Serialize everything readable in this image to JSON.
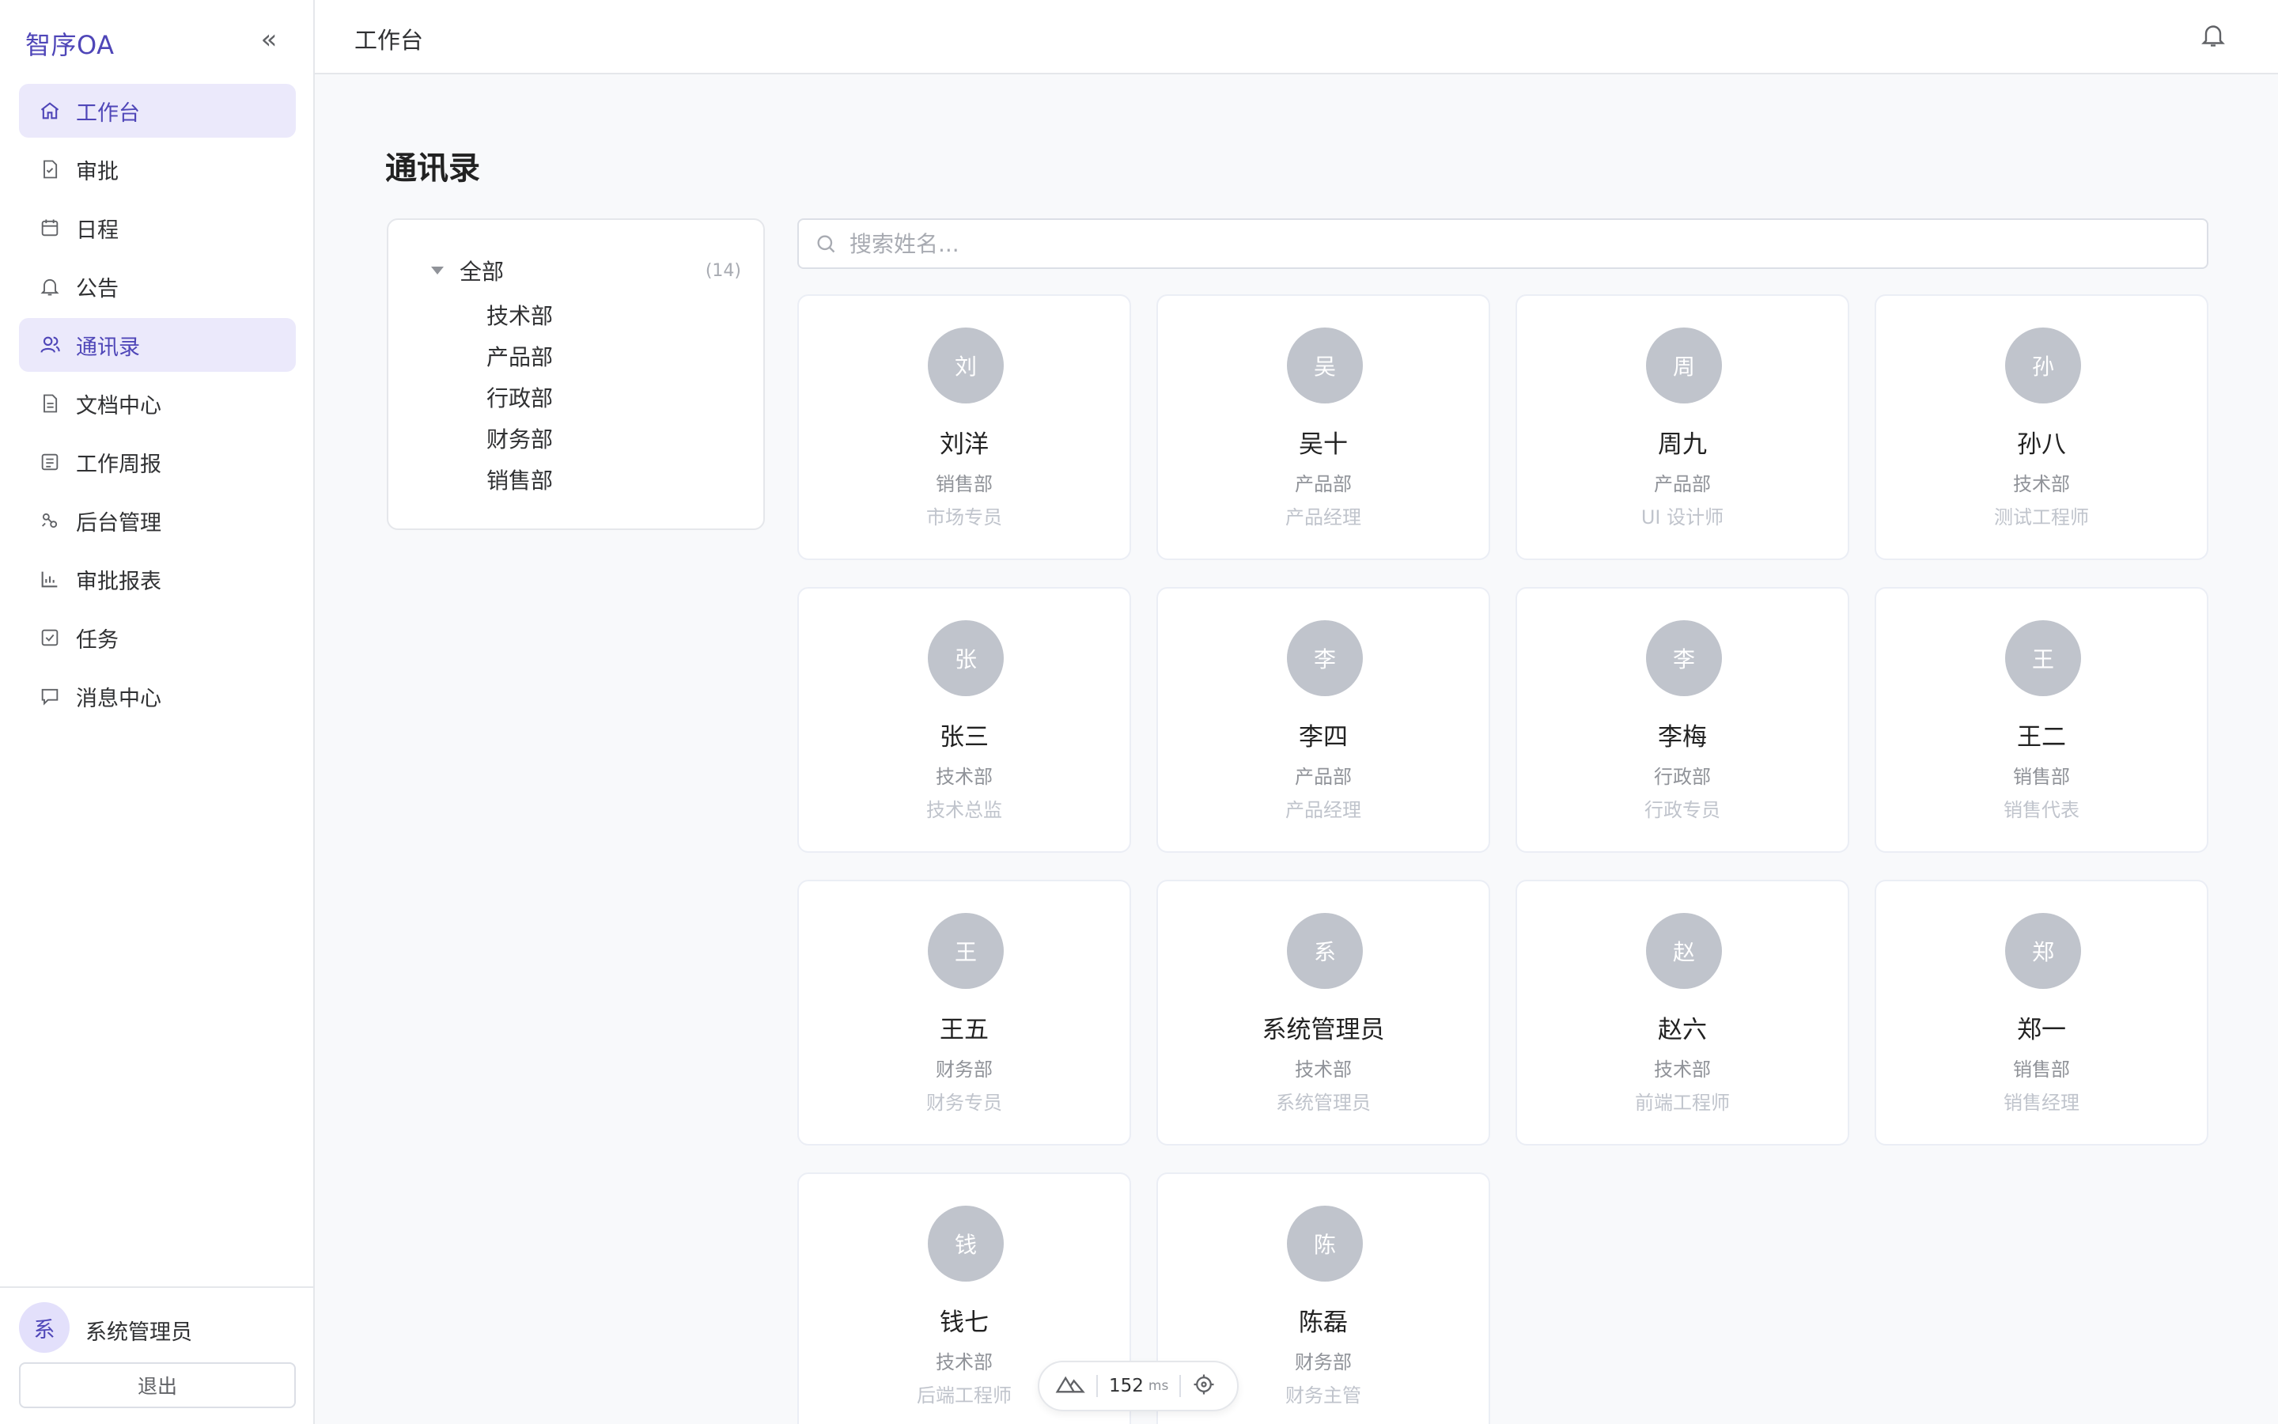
{
  "app": {
    "brand": "智序OA",
    "collapse_glyph": "«"
  },
  "sidebar": {
    "items": [
      {
        "label": "工作台",
        "icon": "home-icon",
        "active": true
      },
      {
        "label": "审批",
        "icon": "approval-doc-icon",
        "active": false
      },
      {
        "label": "日程",
        "icon": "calendar-icon",
        "active": false
      },
      {
        "label": "公告",
        "icon": "bell-icon",
        "active": false
      },
      {
        "label": "通讯录",
        "icon": "contacts-icon",
        "active": true
      },
      {
        "label": "文档中心",
        "icon": "document-icon",
        "active": false
      },
      {
        "label": "工作周报",
        "icon": "report-icon",
        "active": false
      },
      {
        "label": "后台管理",
        "icon": "admin-icon",
        "active": false
      },
      {
        "label": "审批报表",
        "icon": "bar-chart-icon",
        "active": false
      },
      {
        "label": "任务",
        "icon": "task-check-icon",
        "active": false
      },
      {
        "label": "消息中心",
        "icon": "message-icon",
        "active": false
      }
    ],
    "user": {
      "avatar": "系",
      "name": "系统管理员"
    },
    "logout_label": "退出"
  },
  "header": {
    "title": "工作台",
    "notification_icon": "bell-icon"
  },
  "main": {
    "title": "通讯录",
    "tree": {
      "root_label": "全部",
      "root_count": "(14)",
      "children": [
        "技术部",
        "产品部",
        "行政部",
        "财务部",
        "销售部"
      ]
    },
    "search": {
      "placeholder": "搜索姓名...",
      "value": ""
    },
    "contacts": [
      {
        "avatar": "刘",
        "name": "刘洋",
        "dept": "销售部",
        "role": "市场专员"
      },
      {
        "avatar": "吴",
        "name": "吴十",
        "dept": "产品部",
        "role": "产品经理"
      },
      {
        "avatar": "周",
        "name": "周九",
        "dept": "产品部",
        "role": "UI 设计师"
      },
      {
        "avatar": "孙",
        "name": "孙八",
        "dept": "技术部",
        "role": "测试工程师"
      },
      {
        "avatar": "张",
        "name": "张三",
        "dept": "技术部",
        "role": "技术总监"
      },
      {
        "avatar": "李",
        "name": "李四",
        "dept": "产品部",
        "role": "产品经理"
      },
      {
        "avatar": "李",
        "name": "李梅",
        "dept": "行政部",
        "role": "行政专员"
      },
      {
        "avatar": "王",
        "name": "王二",
        "dept": "销售部",
        "role": "销售代表"
      },
      {
        "avatar": "王",
        "name": "王五",
        "dept": "财务部",
        "role": "财务专员"
      },
      {
        "avatar": "系",
        "name": "系统管理员",
        "dept": "技术部",
        "role": "系统管理员"
      },
      {
        "avatar": "赵",
        "name": "赵六",
        "dept": "技术部",
        "role": "前端工程师"
      },
      {
        "avatar": "郑",
        "name": "郑一",
        "dept": "销售部",
        "role": "销售经理"
      },
      {
        "avatar": "钱",
        "name": "钱七",
        "dept": "技术部",
        "role": "后端工程师"
      },
      {
        "avatar": "陈",
        "name": "陈磊",
        "dept": "财务部",
        "role": "财务主管"
      }
    ]
  },
  "perf_widget": {
    "value": "152",
    "unit": "ms"
  },
  "colors": {
    "accent": "#4f46b8",
    "active_bg": "#ebe9fb",
    "avatar_bg": "#c0c4cc"
  }
}
